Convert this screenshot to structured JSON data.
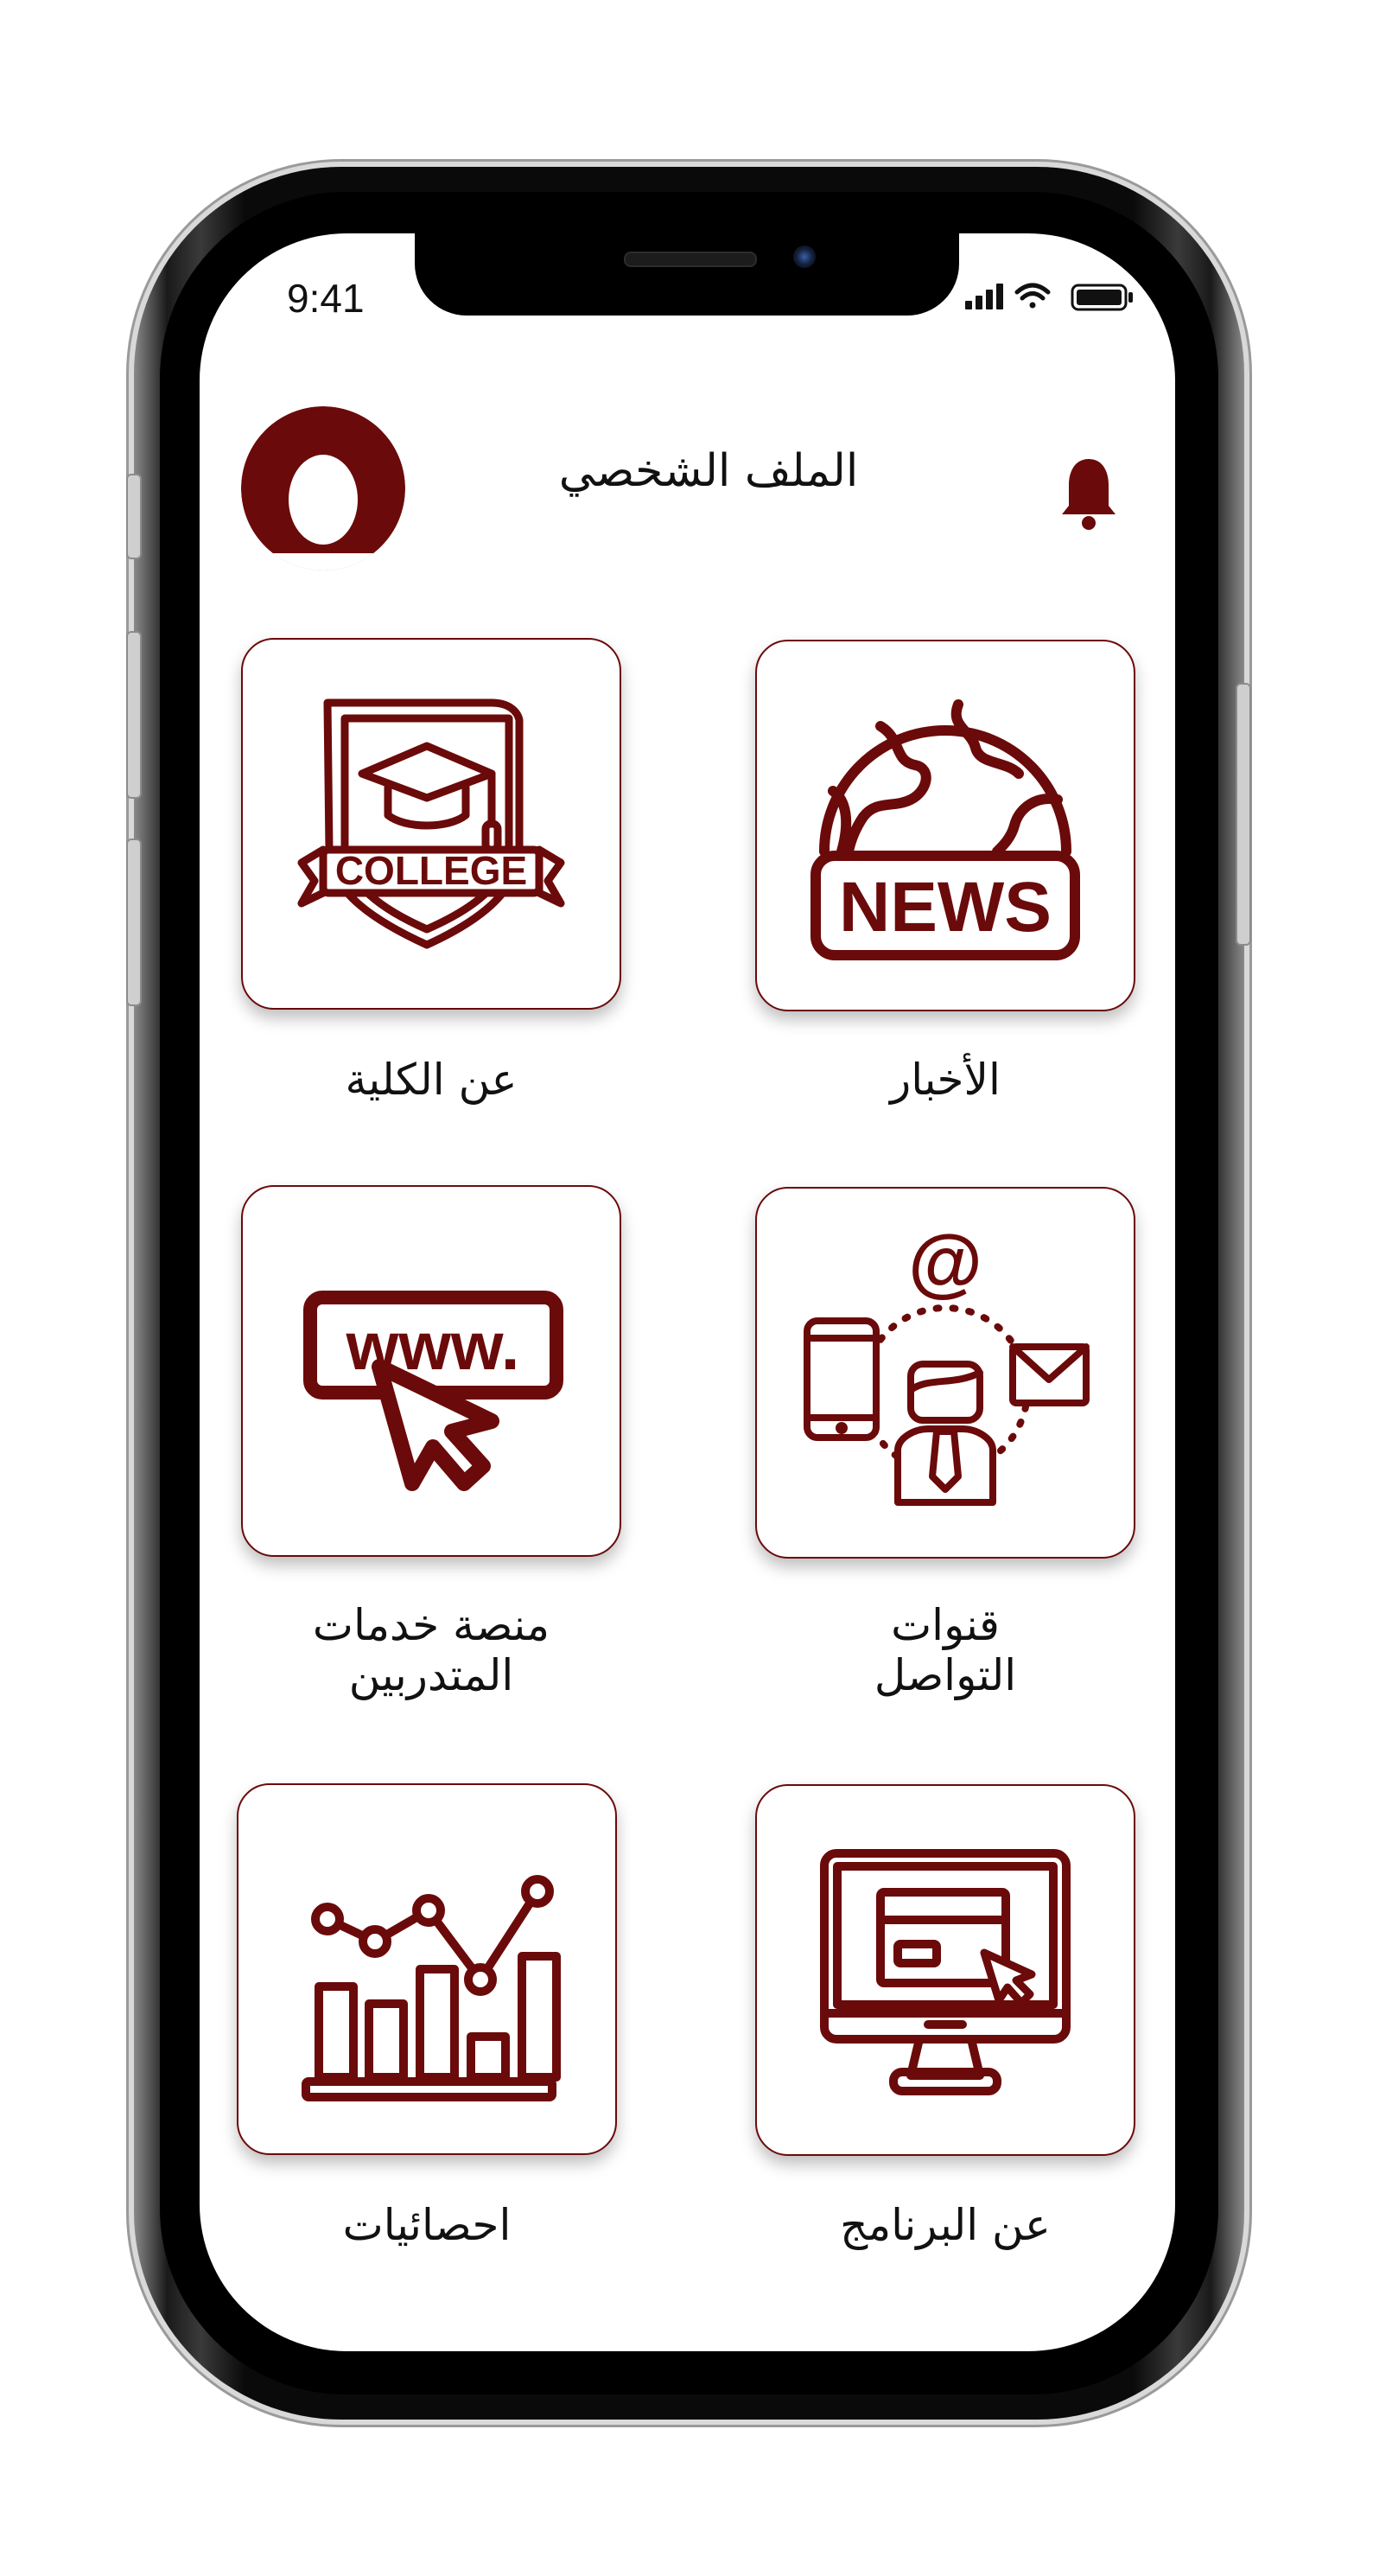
{
  "status_bar": {
    "time": "9:41"
  },
  "header": {
    "title": "الملف الشخصي",
    "avatar_icon": "user-avatar-icon",
    "notification_icon": "bell-icon"
  },
  "tiles": [
    {
      "label": "الأخبار",
      "icon": "news-globe-icon"
    },
    {
      "label": "عن الكلية",
      "icon": "college-badge-icon",
      "icon_text": "COLLEGE"
    },
    {
      "label_line1": "قنوات",
      "label_line2": "التواصل",
      "icon": "communication-channels-icon",
      "icon_text": "@"
    },
    {
      "label_line1": "منصة خدمات",
      "label_line2": "المتدربين",
      "icon": "www-click-icon",
      "icon_text": "www."
    },
    {
      "label": "عن البرنامج",
      "icon": "monitor-icon"
    },
    {
      "label": "احصائيات",
      "icon": "statistics-chart-icon"
    }
  ],
  "news_icon_text": "NEWS",
  "colors": {
    "accent": "#6b0a0a",
    "background": "#ffffff",
    "text": "#111111"
  }
}
